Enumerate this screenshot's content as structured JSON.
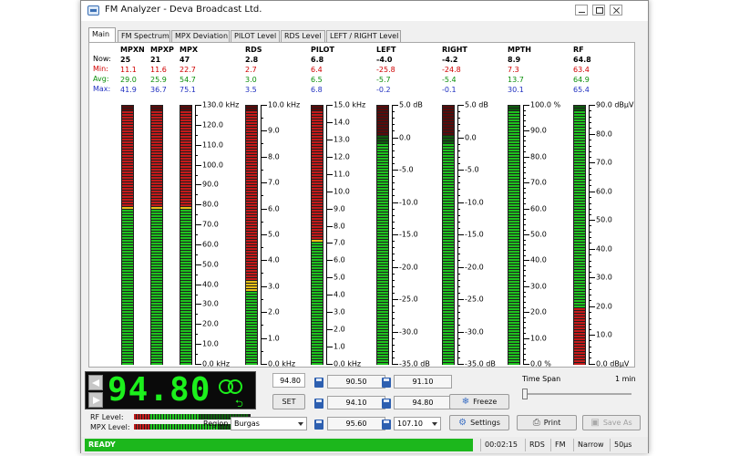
{
  "window": {
    "title": "FM Analyzer - Deva Broadcast Ltd."
  },
  "tabs": [
    {
      "label": "Main",
      "active": true
    },
    {
      "label": "FM Spectrum",
      "active": false
    },
    {
      "label": "MPX Deviation",
      "active": false
    },
    {
      "label": "PILOT Level",
      "active": false
    },
    {
      "label": "RDS Level",
      "active": false
    },
    {
      "label": "LEFT / RIGHT Level",
      "active": false
    }
  ],
  "row_labels": {
    "now": "Now:",
    "min": "Min:",
    "avg": "Avg:",
    "max": "Max:"
  },
  "meters": [
    {
      "name": "MPXN",
      "now": "25",
      "min": "11.1",
      "avg": "29.0",
      "max": "41.9",
      "level": 0.97,
      "yellow_at": 0.6,
      "red_at": 0.61,
      "scale": null
    },
    {
      "name": "MPXP",
      "now": "21",
      "min": "11.6",
      "avg": "25.9",
      "max": "36.7",
      "level": 0.97,
      "yellow_at": 0.6,
      "red_at": 0.61,
      "scale": null
    },
    {
      "name": "MPX",
      "now": "47",
      "min": "22.7",
      "avg": "54.7",
      "max": "75.1",
      "level": 0.97,
      "yellow_at": 0.6,
      "red_at": 0.61,
      "scale": {
        "min": 0,
        "max": 130,
        "labels": [
          "130.0 kHz",
          "120.0",
          "110.0",
          "100.0",
          "90.0",
          "80.0",
          "70.0",
          "60.0",
          "50.0",
          "40.0",
          "30.0",
          "20.0",
          "10.0",
          "0.0 kHz"
        ],
        "minor_per": 1
      }
    },
    {
      "name": "RDS",
      "now": "2.8",
      "min": "2.7",
      "avg": "3.0",
      "max": "3.5",
      "level": 0.97,
      "yellow_at": 0.28,
      "red_at": 0.32,
      "scale": {
        "min": 0,
        "max": 10,
        "labels": [
          "10.0 kHz",
          "9.0",
          "8.0",
          "7.0",
          "6.0",
          "5.0",
          "4.0",
          "3.0",
          "2.0",
          "1.0",
          "0.0 kHz"
        ],
        "minor_per": 1
      }
    },
    {
      "name": "PILOT",
      "now": "6.8",
      "min": "6.4",
      "avg": "6.5",
      "max": "6.8",
      "level": 0.97,
      "yellow_at": 0.47,
      "red_at": 0.48,
      "scale": {
        "min": 0,
        "max": 15,
        "labels": [
          "15.0 kHz",
          "14.0",
          "13.0",
          "12.0",
          "11.0",
          "10.0",
          "9.0",
          "8.0",
          "7.0",
          "6.0",
          "5.0",
          "4.0",
          "3.0",
          "2.0",
          "1.0",
          "0.0 kHz"
        ],
        "minor_per": 0
      }
    },
    {
      "name": "LEFT",
      "now": "-4.0",
      "min": "-25.8",
      "avg": "-5.7",
      "max": "-0.2",
      "level": 0.85,
      "yellow_at": 0.9,
      "red_at": 0.875,
      "scale": {
        "min": -35,
        "max": 5,
        "labels": [
          "5.0 dB",
          "0.0",
          "-5.0",
          "-10.0",
          "-15.0",
          "-20.0",
          "-25.0",
          "-30.0",
          "-35.0 dB"
        ],
        "minor_per": 4
      }
    },
    {
      "name": "RIGHT",
      "now": "-4.2",
      "min": "-24.8",
      "avg": "-5.4",
      "max": "-0.1",
      "level": 0.85,
      "yellow_at": 0.9,
      "red_at": 0.875,
      "scale": {
        "min": -35,
        "max": 5,
        "labels": [
          "5.0 dB",
          "0.0",
          "-5.0",
          "-10.0",
          "-15.0",
          "-20.0",
          "-25.0",
          "-30.0",
          "-35.0 dB"
        ],
        "minor_per": 4
      }
    },
    {
      "name": "MPTH",
      "now": "8.9",
      "min": "7.3",
      "avg": "13.7",
      "max": "30.1",
      "level": 0.97,
      "yellow_at": 1.1,
      "red_at": 1.1,
      "scale": {
        "min": 0,
        "max": 100,
        "labels": [
          "100.0 %",
          "90.0",
          "80.0",
          "70.0",
          "60.0",
          "50.0",
          "40.0",
          "30.0",
          "20.0",
          "10.0",
          "0.0 %"
        ],
        "minor_per": 4
      }
    },
    {
      "name": "RF",
      "now": "64.8",
      "min": "63.4",
      "avg": "64.9",
      "max": "65.4",
      "level": 0.97,
      "yellow_at": 1.1,
      "red_at": 1.1,
      "low_red_to": 0.22,
      "scale": {
        "min": 0,
        "max": 90,
        "labels": [
          "90.0 dBμV",
          "80.0",
          "70.0",
          "60.0",
          "50.0",
          "40.0",
          "30.0",
          "20.0",
          "10.0",
          "0.0 dBμV"
        ],
        "minor_per": 4
      }
    }
  ],
  "tuner": {
    "frequency_display": "94.80",
    "frequency_field": "94.80",
    "set_label": "SET",
    "rf_level_label": "RF Level:",
    "mpx_level_label": "MPX Level:",
    "rf_level": 0.55,
    "mpx_level": 0.72,
    "region_label": "Region",
    "region_value": "Burgas",
    "presets": [
      "90.50",
      "91.10",
      "94.10",
      "94.80",
      "95.60",
      "107.10"
    ],
    "freeze_label": "Freeze",
    "settings_label": "Settings",
    "print_label": "Print",
    "saveas_label": "Save As",
    "timespan_label": "Time Span",
    "timespan_value": "1 min"
  },
  "statusbar": {
    "ready": "READY",
    "time": "00:02:15",
    "rds": "RDS",
    "mode": "FM",
    "bandwidth": "Narrow",
    "deemphasis": "50μs"
  },
  "colors": {
    "green": "#1ec21e",
    "green_dark": "#0e5c0e",
    "red": "#c41a1a",
    "red_dark": "#5a0a0a",
    "yellow": "#e8c018",
    "accent": "#1cb71c"
  }
}
